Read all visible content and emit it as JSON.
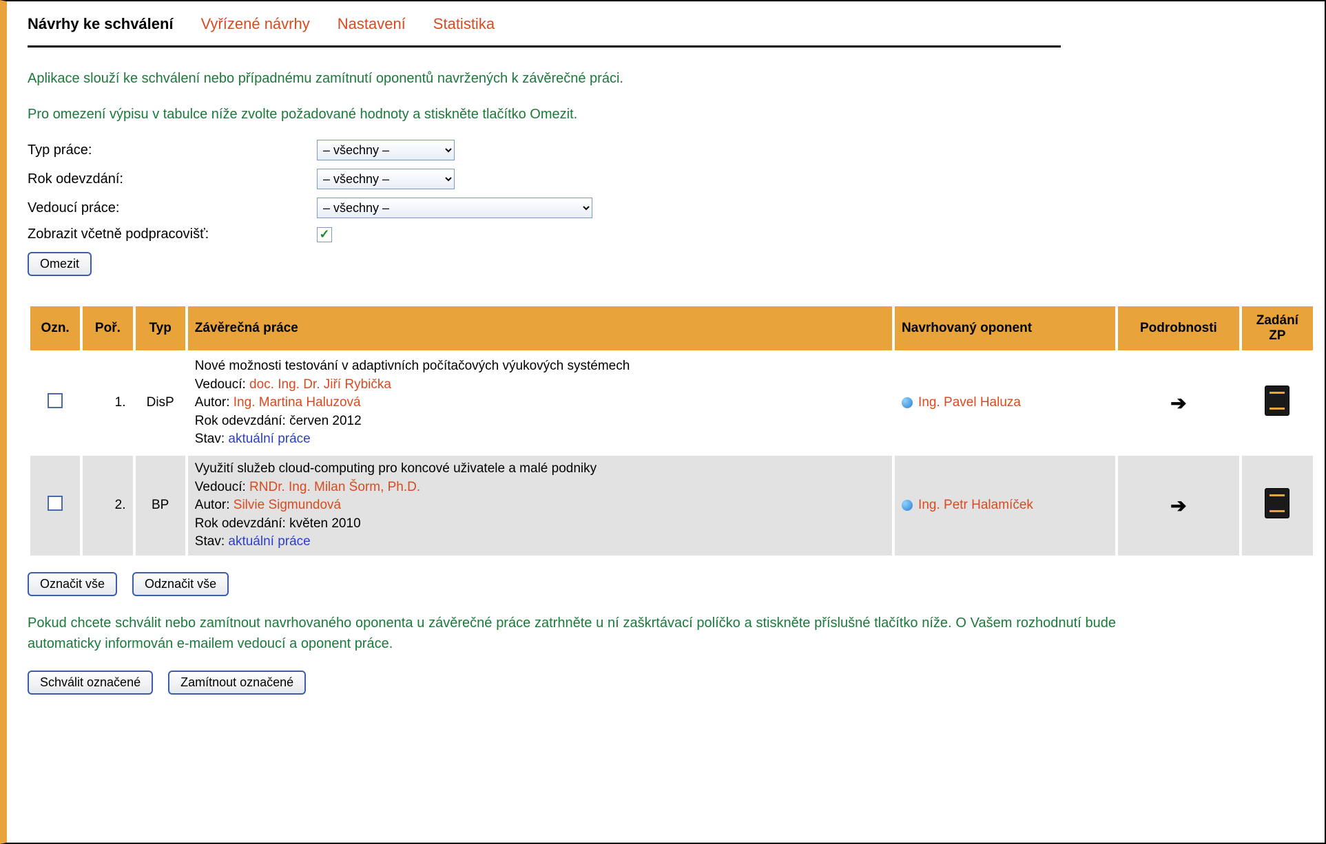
{
  "tabs": {
    "active": "Návrhy ke schválení",
    "items": [
      "Vyřízené návrhy",
      "Nastavení",
      "Statistika"
    ]
  },
  "intro1": "Aplikace slouží ke schválení nebo případnému zamítnutí oponentů navržených k závěrečné práci.",
  "intro2": "Pro omezení výpisu v tabulce níže zvolte požadované hodnoty a stiskněte tlačítko Omezit.",
  "filters": {
    "type_label": "Typ práce:",
    "year_label": "Rok odevzdání:",
    "supervisor_label": "Vedoucí práce:",
    "subdept_label": "Zobrazit včetně podpracovišť:",
    "all_option": "– všechny –"
  },
  "buttons": {
    "limit": "Omezit",
    "select_all": "Označit vše",
    "deselect_all": "Odznačit vše",
    "approve": "Schválit označené",
    "reject": "Zamítnout označené"
  },
  "table": {
    "headers": {
      "ozn": "Ozn.",
      "por": "Poř.",
      "typ": "Typ",
      "zp": "Závěrečná práce",
      "opponent": "Navrhovaný oponent",
      "details": "Podrobnosti",
      "zadani": "Zadání ZP"
    },
    "labels": {
      "vedouci": "Vedoucí: ",
      "autor": "Autor: ",
      "rok": "Rok odevzdání: ",
      "stav": "Stav: "
    },
    "rows": [
      {
        "por": "1.",
        "typ": "DisP",
        "title": "Nové možnosti testování v adaptivních počítačových výukových systémech",
        "vedouci": "doc. Ing. Dr. Jiří Rybička",
        "autor": "Ing. Martina Haluzová",
        "rok": "červen 2012",
        "stav": "aktuální práce",
        "opponent": "Ing. Pavel Haluza"
      },
      {
        "por": "2.",
        "typ": "BP",
        "title": "Využití služeb cloud-computing pro koncové uživatele a malé podniky",
        "vedouci": "RNDr. Ing. Milan Šorm, Ph.D.",
        "autor": "Silvie Sigmundová",
        "rok": "květen 2010",
        "stav": "aktuální práce",
        "opponent": "Ing. Petr Halamíček"
      }
    ]
  },
  "help": "Pokud chcete schválit nebo zamítnout navrhovaného oponenta u závěrečné práce zatrhněte u ní zaškrtávací políčko a stiskněte příslušné tlačítko níže. O Vašem rozhodnutí bude automaticky informován e-mailem vedoucí a oponent práce."
}
